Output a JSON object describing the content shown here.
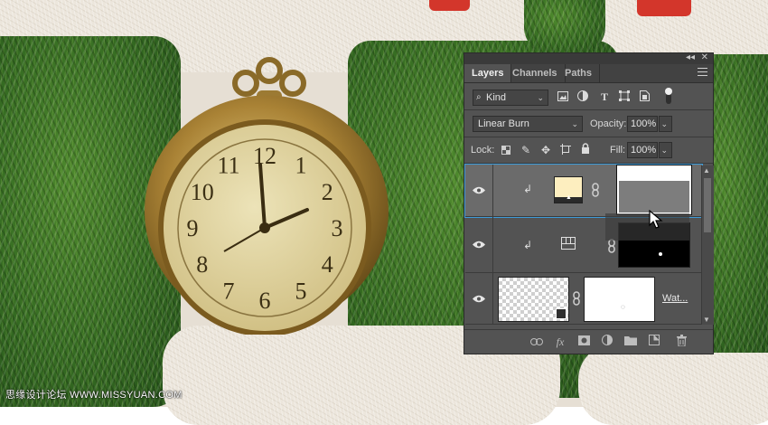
{
  "panel": {
    "tabs": [
      {
        "label": "Layers",
        "active": true
      },
      {
        "label": "Channels",
        "active": false
      },
      {
        "label": "Paths",
        "active": false
      }
    ],
    "collapse_glyph": "◂◂",
    "close_glyph": "✕",
    "filter": {
      "label": "Kind",
      "icon": "search-icon"
    },
    "filter_icons": [
      "image-filter-icon",
      "adjustment-filter-icon",
      "type-filter-icon",
      "shape-filter-icon",
      "smart-object-filter-icon",
      "toggle-filter-icon"
    ],
    "blend_mode": "Linear Burn",
    "opacity_label": "Opacity:",
    "opacity_value": "100%",
    "lock_label": "Lock:",
    "lock_icons": [
      "lock-transparent-icon",
      "lock-pixels-icon",
      "lock-position-icon",
      "lock-artboard-icon",
      "lock-all-icon"
    ],
    "fill_label": "Fill:",
    "fill_value": "100%",
    "layers": [
      {
        "type": "solid-color-fill",
        "clipped": true,
        "selected": true,
        "fill_color": "#fdeebf"
      },
      {
        "type": "levels-adjustment",
        "clipped": true,
        "selected": false
      },
      {
        "name": "Wat...",
        "type": "smart-object",
        "selected": false
      }
    ],
    "footer_icons": [
      "link-layers-icon",
      "fx-icon",
      "add-mask-icon",
      "new-adjustment-icon",
      "new-group-icon",
      "new-layer-icon",
      "trash-icon"
    ],
    "footer_fx_text": "fx"
  },
  "watermark": "思缘设计论坛 WWW.MISSYUAN.COM",
  "colors": {
    "panel_bg": "#535353",
    "selection_outline": "#3e9bd8",
    "grass": "#356b22",
    "fur": "#ece6dc",
    "watch_gold": "#b08a3a",
    "watch_face": "#e3d8a4"
  },
  "watch_face_numbers": [
    "12",
    "1",
    "2",
    "3",
    "4",
    "5",
    "6",
    "7",
    "8",
    "9",
    "10",
    "11"
  ]
}
